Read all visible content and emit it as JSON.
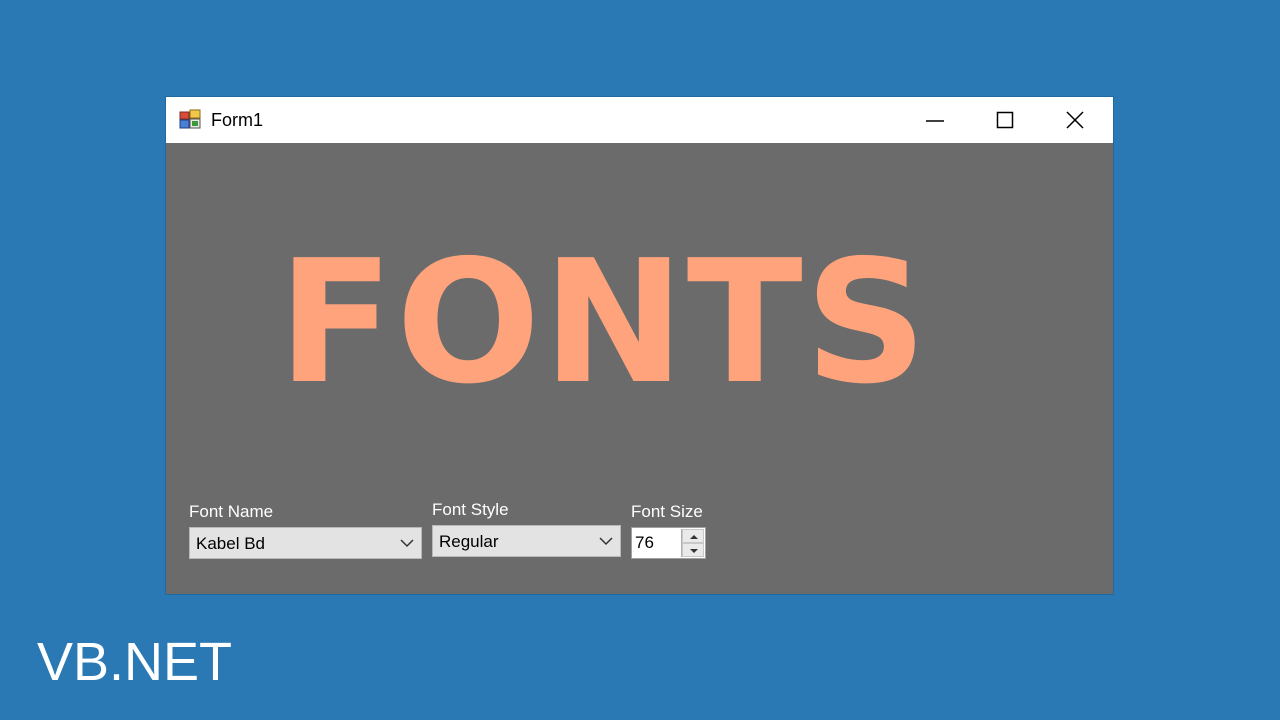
{
  "window": {
    "title": "Form1"
  },
  "preview": {
    "text": "FONTS",
    "color": "#ffa37c"
  },
  "controls": {
    "font_name_label": "Font Name",
    "font_name_value": "Kabel Bd",
    "font_style_label": "Font Style",
    "font_style_value": "Regular",
    "font_size_label": "Font Size",
    "font_size_value": "76"
  },
  "overlay": {
    "brand_text": "VB.NET"
  },
  "icons": {
    "app": "form-app-icon",
    "minimize": "minimize-icon",
    "maximize": "maximize-icon",
    "close": "close-icon",
    "dropdown": "chevron-down-icon",
    "spin_up": "spin-up-icon",
    "spin_down": "spin-down-icon"
  },
  "colors": {
    "desktop": "#2a79b4",
    "client_background": "#6b6b6b",
    "titlebar": "#ffffff"
  }
}
